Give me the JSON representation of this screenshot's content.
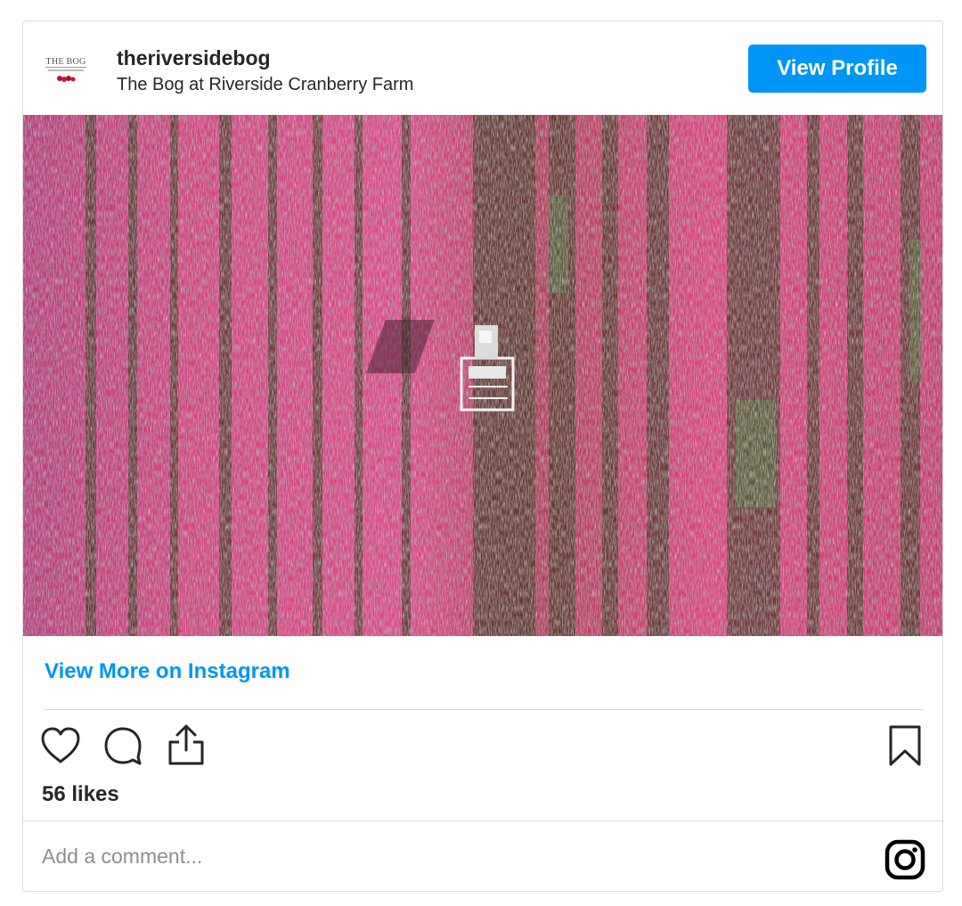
{
  "header": {
    "avatar_logo_text": "THE BOG",
    "username": "theriversidebog",
    "full_name": "The Bog at Riverside Cranberry Farm",
    "view_profile_label": "View Profile"
  },
  "photo": {
    "icon": "cranberry-bog-aerial-photo",
    "dominant_colors": [
      "#d8307a",
      "#e94d8f",
      "#5a3a2a",
      "#4f6a3a",
      "#ffffff"
    ]
  },
  "view_more_label": "View More on Instagram",
  "actions": {
    "like_icon": "heart-icon",
    "comment_icon": "comment-icon",
    "share_icon": "share-icon",
    "save_icon": "bookmark-icon"
  },
  "likes_text": "56 likes",
  "comment": {
    "placeholder": "Add a comment...",
    "value": "",
    "brand_icon": "instagram-icon"
  },
  "colors": {
    "accent": "#0095f6",
    "text": "#262626",
    "muted": "#8e8e8e",
    "border": "#dbdbdb"
  }
}
